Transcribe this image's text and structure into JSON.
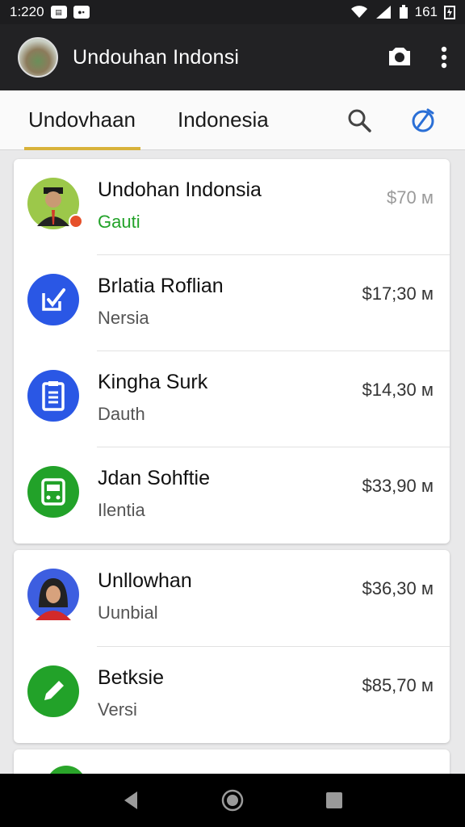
{
  "status_bar": {
    "time": "1:220",
    "battery": "161"
  },
  "app_bar": {
    "title": "Undouhan Indonsi"
  },
  "tabs": [
    {
      "label": "Undovhaan",
      "active": true
    },
    {
      "label": "Indonesia",
      "active": false
    }
  ],
  "colors": {
    "accent": "#d8b23a",
    "green": "#22a229",
    "blue": "#2a57e5"
  },
  "list_groups": [
    {
      "rows": [
        {
          "name": "Undohan Indonsia",
          "sub": "Gauti",
          "price": "$70 м",
          "icon": "profile-photo-icon",
          "sub_color": "#22a229",
          "price_color": "#9a9a9a"
        },
        {
          "name": "Brlatia Roflian",
          "sub": "Nersia",
          "price": "$17;30 м",
          "icon": "edit-check-icon"
        },
        {
          "name": "Kingha Surk",
          "sub": "Dauth",
          "price": "$14,30 м",
          "icon": "document-icon"
        },
        {
          "name": "Jdan Sohftie",
          "sub": "Ilentia",
          "price": "$33,90 м",
          "icon": "card-icon"
        }
      ]
    },
    {
      "rows": [
        {
          "name": "Unllowhan",
          "sub": "Uunbial",
          "price": "$36,30 м",
          "icon": "profile-photo-icon"
        },
        {
          "name": "Betksie",
          "sub": "Versi",
          "price": "$85,70 м",
          "icon": "pencil-icon"
        }
      ]
    }
  ]
}
